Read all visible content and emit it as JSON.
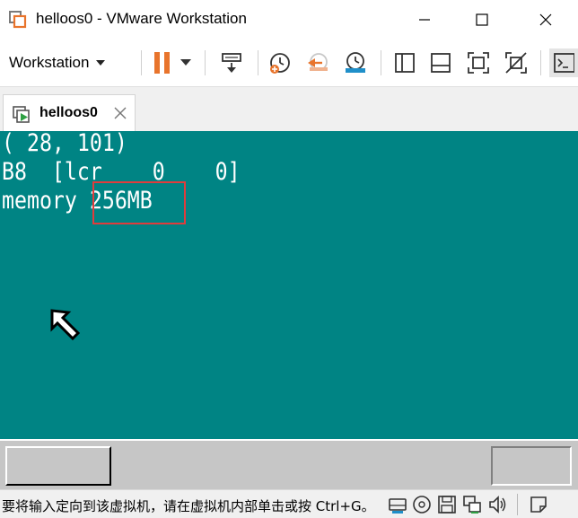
{
  "window": {
    "title": "helloos0 - VMware Workstation",
    "icon": "vmware-app-icon",
    "controls": [
      "minimize-icon",
      "maximize-icon",
      "close-icon"
    ]
  },
  "toolbar": {
    "menu_label": "Workstation",
    "icons": [
      "pause-icon",
      "pause-dropdown-icon",
      "send-ctrl-alt-del-icon",
      "snapshot-take-icon",
      "snapshot-revert-icon",
      "snapshot-manager-icon",
      "show-library-icon",
      "thumbnail-bar-icon",
      "full-screen-icon",
      "unity-icon",
      "console-view-icon"
    ],
    "accent_color": "#e8742c"
  },
  "tabs": [
    {
      "label": "helloos0",
      "icon": "vm-running-icon",
      "active": true
    }
  ],
  "vm_screen": {
    "background": "#008484",
    "lines": [
      "( 28, 101)",
      "B8  [lcr    0    0]",
      "memory 256MB"
    ],
    "highlighted_text": "256MB",
    "highlight_color": "#e03c3c"
  },
  "status_bar": {
    "message": "要将输入定向到该虚拟机，请在虚拟机内部单击或按 Ctrl+G。",
    "device_icons": [
      "hard-disk-icon",
      "cd-dvd-icon",
      "floppy-icon",
      "network-adapter-icon",
      "sound-icon",
      "message-icon"
    ]
  }
}
